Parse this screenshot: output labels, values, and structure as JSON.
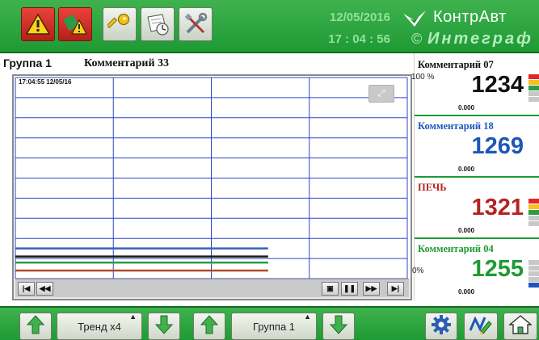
{
  "toolbar": {
    "buttons": [
      {
        "name": "alarm-icon"
      },
      {
        "name": "alarm-ack-icon"
      },
      {
        "name": "key-icon"
      },
      {
        "name": "archive-icon"
      },
      {
        "name": "tools-icon"
      }
    ],
    "date": "12/05/2016",
    "time": "17 : 04 : 56",
    "brand": "КонтрАвт",
    "brand_sub": "Интеграф",
    "copyright": "©"
  },
  "group": {
    "name": "Группа 1",
    "comment": "Комментарий 33"
  },
  "chart": {
    "timestamp": "17:04:55  12/05/16",
    "colors": {
      "grid": "#2e46c9",
      "series": [
        "#3b5fbf",
        "#1a1a1a",
        "#2a9a4a",
        "#b04a2a"
      ]
    }
  },
  "chart_data": {
    "type": "line",
    "title": "",
    "xlabel": "",
    "ylabel": "",
    "ylim": [
      0,
      100
    ],
    "series": [
      {
        "values": [
          15,
          15
        ]
      },
      {
        "values": [
          11,
          11
        ]
      },
      {
        "values": [
          8,
          8
        ]
      },
      {
        "values": [
          4,
          4
        ]
      }
    ]
  },
  "navigation": {
    "first": "|◀",
    "rewind": "◀◀",
    "marker": "▣",
    "pause": "❚❚",
    "forward": "▶▶",
    "last": "▶|"
  },
  "channels": [
    {
      "name": "Комментарий 07",
      "value": "1234",
      "sub": "0.000",
      "color": "#111111",
      "pct_top": "100 %"
    },
    {
      "name": "Комментарий 18",
      "value": "1269",
      "sub": "0.000",
      "color": "#1f56b8"
    },
    {
      "name": "ПЕЧЬ",
      "value": "1321",
      "sub": "0.000",
      "color": "#b32424"
    },
    {
      "name": "Комментарий 04",
      "value": "1255",
      "sub": "0.000",
      "color": "#1f9a34",
      "pct_bottom": "0%"
    }
  ],
  "bottom": {
    "trend_label": "Тренд x4",
    "group_label": "Группа 1",
    "icons": [
      "arrow-up-icon",
      "arrow-down-icon",
      "gear-icon",
      "trend-edit-icon",
      "home-icon"
    ]
  }
}
